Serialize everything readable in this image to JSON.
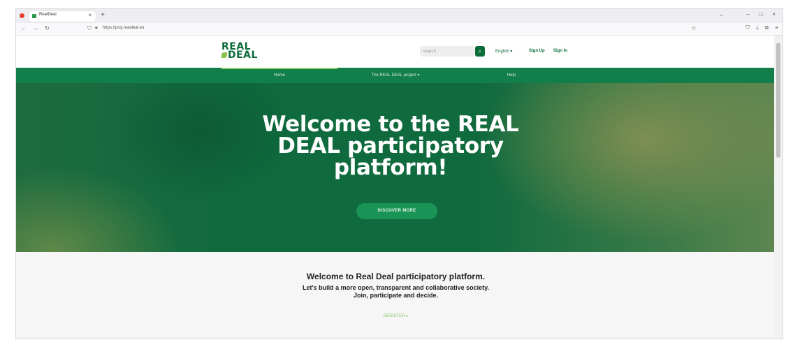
{
  "browser": {
    "tab_title": "RealDeal",
    "tab_close": "×",
    "new_tab": "+",
    "tabs_list": "⌄",
    "window_controls": [
      "–",
      "□",
      "×"
    ],
    "nav_buttons": [
      "←",
      "→",
      "↻"
    ],
    "url": "https://proj.realdeal.eu",
    "url_star": "☆",
    "toolbar_icons": [
      "⛉",
      "⤓",
      "⧉",
      "≡"
    ]
  },
  "site": {
    "logo_line1": "REAL",
    "logo_line2": "DEAL",
    "search_placeholder": "Search",
    "search_icon": "⌕",
    "language": "English ▾",
    "sign_up": "Sign Up",
    "sign_in": "Sign In",
    "nav": {
      "home": "Home",
      "project": "The REAL DEAL project ▾",
      "help": "Help"
    },
    "hero": {
      "title_line1": "Welcome to the REAL",
      "title_line2": "DEAL participatory",
      "title_line3": "platform!",
      "button": "DISCOVER MORE"
    },
    "welcome": {
      "heading": "Welcome to Real Deal participatory platform.",
      "line1": "Let's build a more open, transparent and collaborative society.",
      "line2": "Join, participate and decide.",
      "register": "REGISTER ▸"
    }
  },
  "colors": {
    "brand_green": "#0b6b3a",
    "nav_green": "#127f4a",
    "button_green": "#199456",
    "accent_lime": "#9bd36f"
  }
}
